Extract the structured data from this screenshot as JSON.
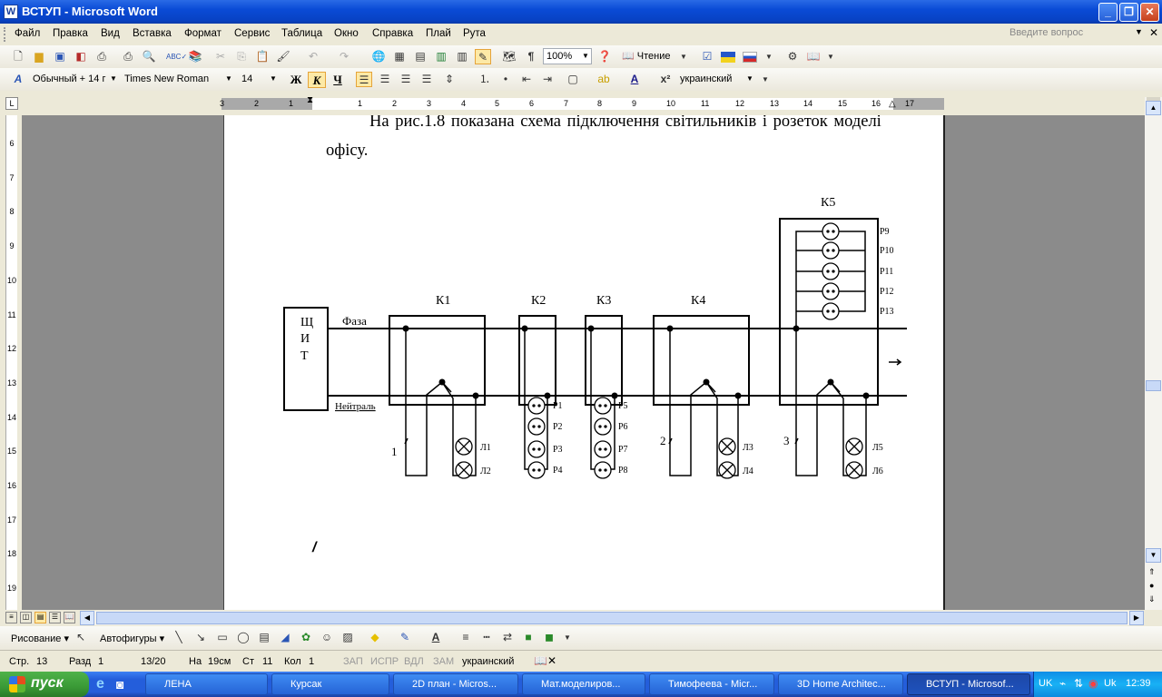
{
  "window": {
    "title": "ВСТУП - Microsoft Word"
  },
  "menu": {
    "items": [
      "Файл",
      "Правка",
      "Вид",
      "Вставка",
      "Формат",
      "Сервис",
      "Таблица",
      "Окно",
      "Справка",
      "Плай",
      "Рута"
    ],
    "help_placeholder": "Введите вопрос"
  },
  "toolbar": {
    "zoom": "100%",
    "reading_label": "Чтение"
  },
  "formatting": {
    "style": "Обычный + 14 г",
    "font": "Times New Roman",
    "size": "14",
    "bold": "Ж",
    "italic": "К",
    "underline": "Ч",
    "language": "украинский"
  },
  "ruler": {
    "labels": [
      "3",
      "2",
      "1",
      "1",
      "2",
      "3",
      "4",
      "5",
      "6",
      "7",
      "8",
      "9",
      "10",
      "11",
      "12",
      "13",
      "14",
      "15",
      "16",
      "17"
    ],
    "vlabels": [
      "6",
      "7",
      "8",
      "9",
      "10",
      "11",
      "12",
      "13",
      "14",
      "15",
      "16",
      "17",
      "18",
      "19"
    ]
  },
  "document": {
    "line1": "На  рис.1.8 показана схема підключення світильників і розеток моделі",
    "line2": "офісу.",
    "cursor_char": "/"
  },
  "diagram": {
    "panel_letters": [
      "Щ",
      "И",
      "Т"
    ],
    "phase": "Фаза",
    "neutral": "Нейтраль",
    "boxes": [
      "К1",
      "К2",
      "К3",
      "К4",
      "К5"
    ],
    "sockets_k2": [
      "Р1",
      "Р2",
      "Р3",
      "Р4"
    ],
    "sockets_k3": [
      "Р5",
      "Р6",
      "Р7",
      "Р8"
    ],
    "sockets_k5": [
      "Р9",
      "Р10",
      "Р11",
      "Р12",
      "Р13"
    ],
    "lamps_k1": [
      "Л1",
      "Л2"
    ],
    "lamps_k4": [
      "Л3",
      "Л4"
    ],
    "lamps_k5": [
      "Л5",
      "Л6"
    ],
    "switches": [
      "1",
      "2",
      "3"
    ]
  },
  "drawing": {
    "draw_label": "Рисование",
    "autoshapes_label": "Автофигуры"
  },
  "status": {
    "page": "Стр.",
    "page_num": "13",
    "section": "Разд",
    "section_num": "1",
    "pages": "13/20",
    "at": "На",
    "at_value": "19см",
    "line": "Ст",
    "line_num": "11",
    "col": "Кол",
    "col_num": "1",
    "rec": "ЗАП",
    "trk": "ИСПР",
    "ext": "ВДЛ",
    "ovr": "ЗАМ",
    "language": "украинский"
  },
  "taskbar": {
    "start": "пуск",
    "tasks": [
      "ЛЕНА",
      "Курсак",
      "2D план - Micros...",
      "Мат.моделиров...",
      "Тимофеева - Micr...",
      "3D Home Architec...",
      "ВСТУП - Microsof..."
    ],
    "lang": "UK",
    "tray_lang": "Uk",
    "time": "12:39"
  }
}
